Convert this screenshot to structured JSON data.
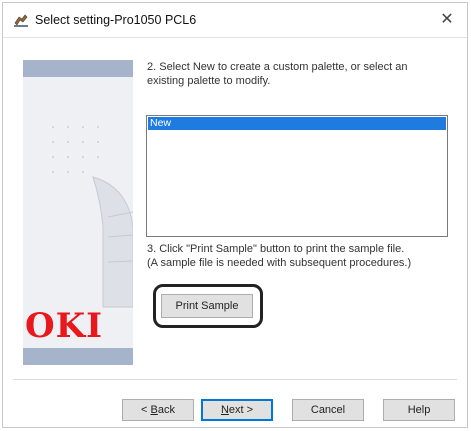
{
  "window": {
    "title": "Select setting-Pro1050 PCL6",
    "close_glyph": "✕"
  },
  "side_panel": {
    "logo_text": "OKI",
    "logo_color": "#e8181c",
    "band_color": "#a5b4ca"
  },
  "step2": {
    "text": "2. Select New to create a custom palette, or select an existing palette to modify."
  },
  "palette_list": {
    "items": [
      "New"
    ],
    "selected_index": 0,
    "selection_color": "#1f7be0"
  },
  "step3": {
    "line1": "3. Click \"Print Sample\" button to print the sample file.",
    "line2": "(A sample file is needed with subsequent procedures.)"
  },
  "buttons": {
    "print_sample": "Print Sample",
    "back_prefix": "< ",
    "back_key": "B",
    "back_rest": "ack",
    "next_key": "N",
    "next_rest": "ext >",
    "cancel": "Cancel",
    "help": "Help"
  },
  "icons": {
    "app": "printer-settings-icon",
    "close": "close-icon"
  }
}
